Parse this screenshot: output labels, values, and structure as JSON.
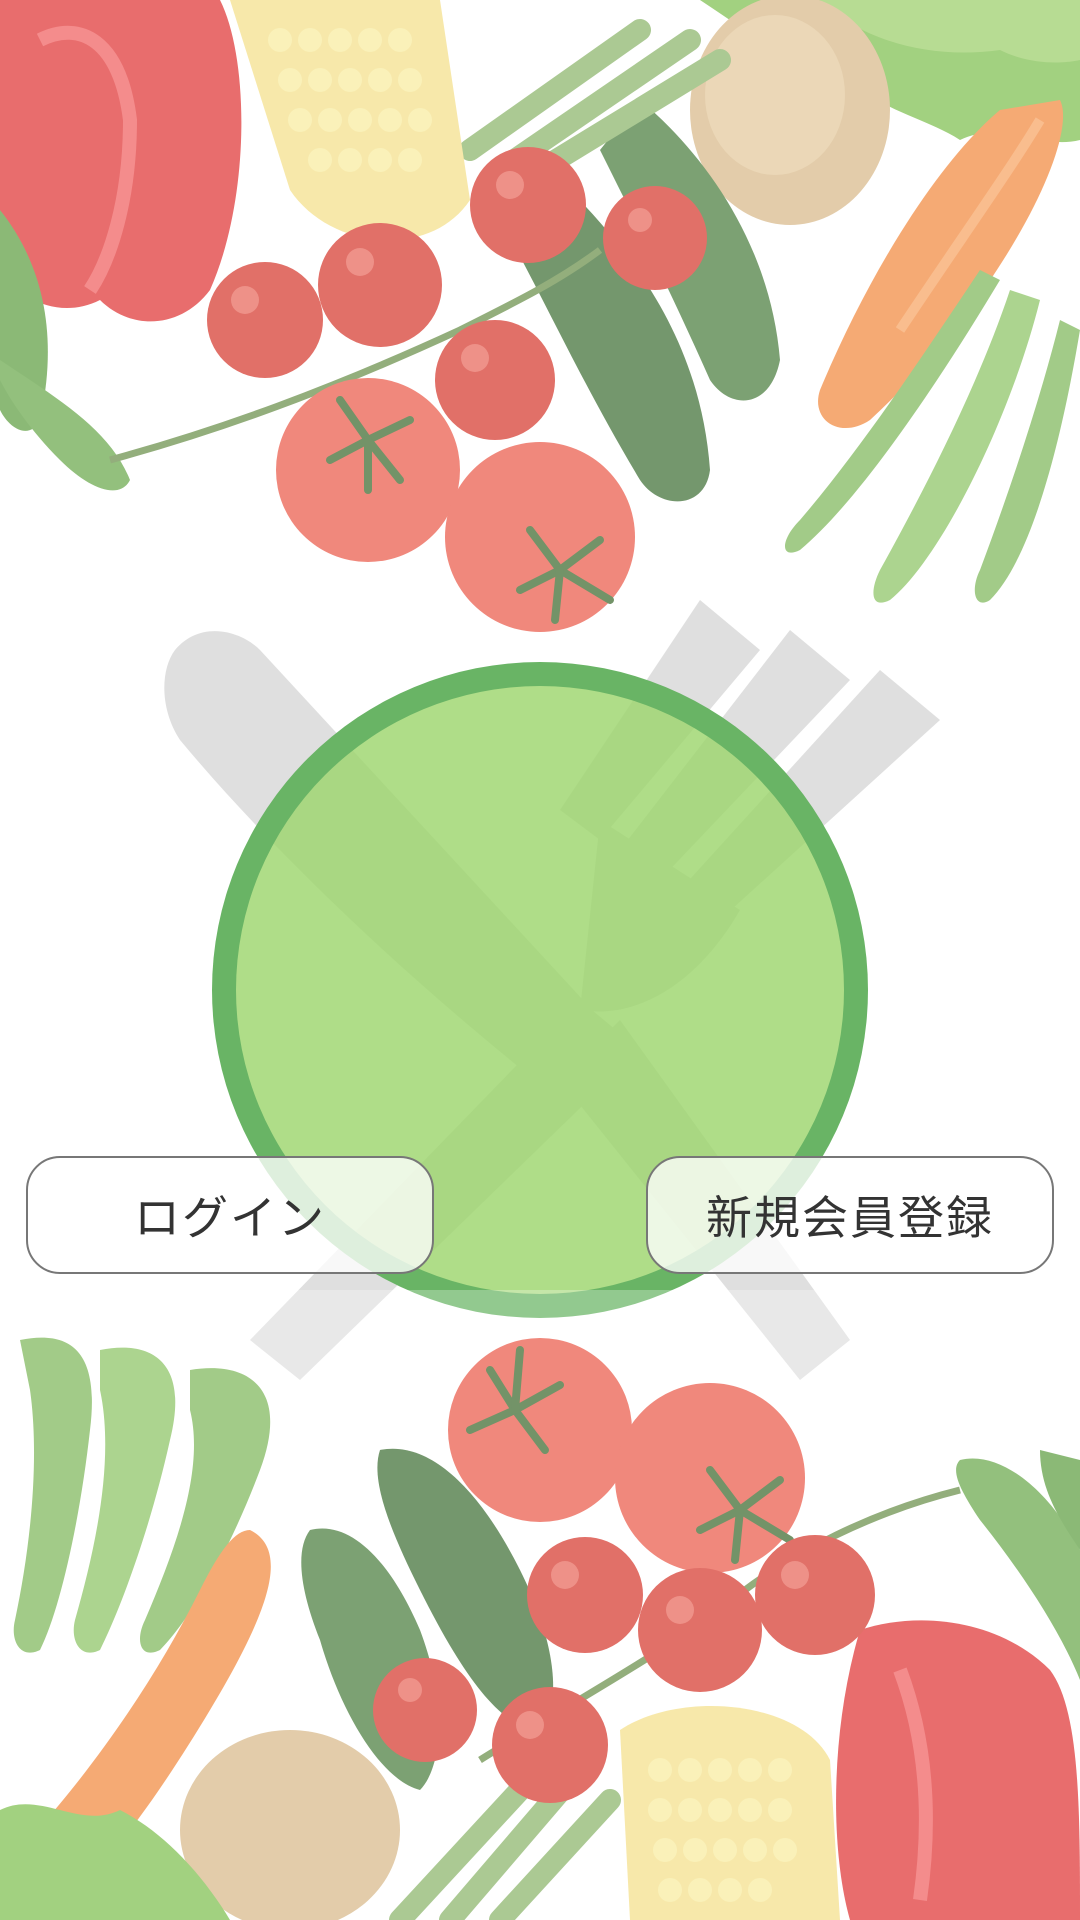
{
  "buttons": {
    "login_label": "ログイン",
    "register_label": "新規会員登録"
  },
  "colors": {
    "logo_fill": "#a8dc7e",
    "logo_ring": "#6ab56a",
    "button_border": "#777777",
    "button_text": "#333333",
    "utensil_watermark": "#dcdcdc"
  },
  "images": {
    "top": "vegetables-photo",
    "bottom": "vegetables-photo",
    "watermark": "knife-and-fork-icon",
    "logo": "green-circle-logo"
  }
}
